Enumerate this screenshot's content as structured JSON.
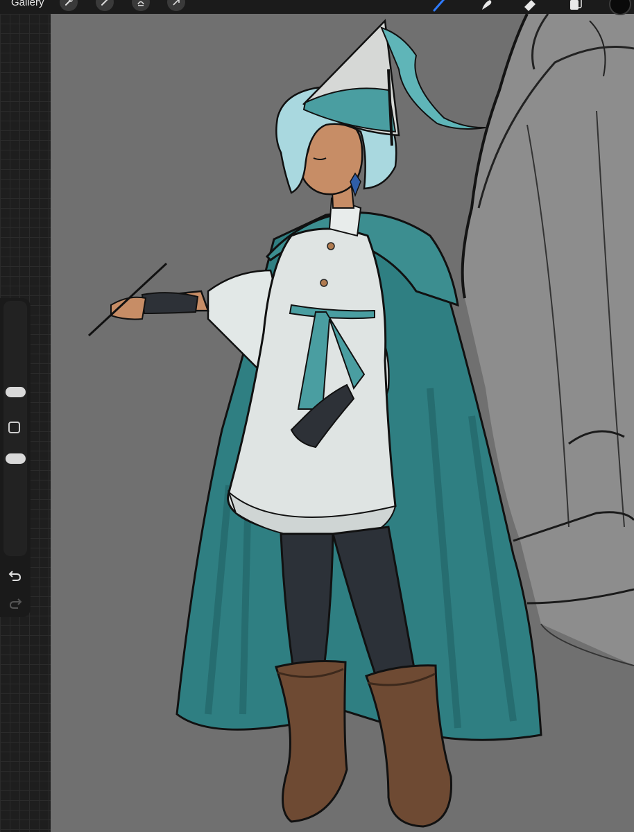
{
  "toolbar": {
    "gallery_label": "Gallery",
    "left_tools": [
      "wrench-icon",
      "magic-wand-icon",
      "selection-icon",
      "transform-arrow-icon"
    ],
    "right_tools": [
      "brush-icon",
      "smudge-icon",
      "eraser-icon",
      "layers-icon"
    ],
    "active_tool": "brush-icon",
    "accent_color": "#2f7bff",
    "current_color": "#0a0a0a"
  },
  "sidebar": {
    "controls": [
      "brush-size-slider",
      "modify-button",
      "opacity-slider",
      "undo-button",
      "redo-button"
    ]
  },
  "canvas": {
    "background_color": "#707070",
    "palette": {
      "cape": "#2f7f82",
      "hair": "#a9d8df",
      "tunic": "#dfe4e3",
      "skin": "#c78d66",
      "leggings": "#2c3138",
      "boots": "#6e4a33",
      "hat": "#d6d8d6",
      "gloves": "#2d3137"
    }
  }
}
